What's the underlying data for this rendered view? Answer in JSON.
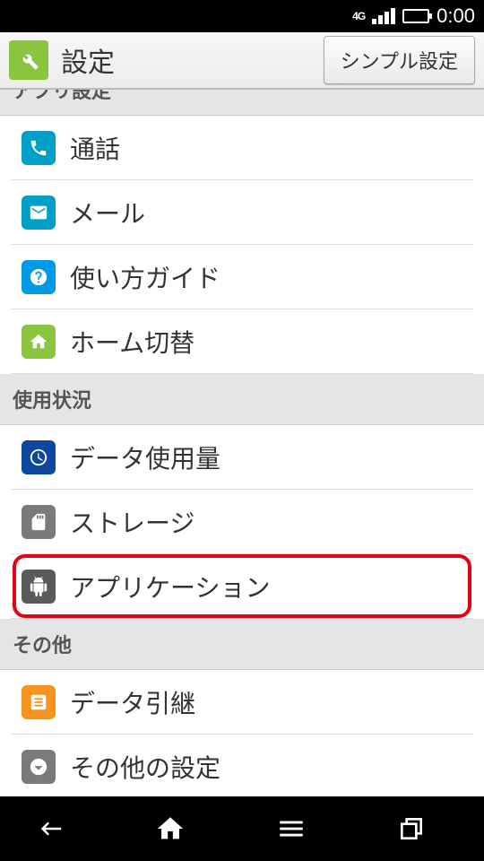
{
  "status": {
    "network": "4G",
    "time": "0:00"
  },
  "header": {
    "title": "設定",
    "simple_button": "シンプル設定"
  },
  "sections": {
    "app_settings": {
      "header": "アプリ設定"
    },
    "usage": {
      "header": "使用状況"
    },
    "other": {
      "header": "その他"
    }
  },
  "rows": {
    "call": {
      "label": "通話"
    },
    "mail": {
      "label": "メール"
    },
    "guide": {
      "label": "使い方ガイド"
    },
    "home_switch": {
      "label": "ホーム切替"
    },
    "data_usage": {
      "label": "データ使用量"
    },
    "storage": {
      "label": "ストレージ"
    },
    "application": {
      "label": "アプリケーション"
    },
    "data_transfer": {
      "label": "データ引継"
    },
    "other_settings": {
      "label": "その他の設定"
    }
  },
  "colors": {
    "highlight": "#e60012",
    "accent_green": "#8bc53f"
  }
}
